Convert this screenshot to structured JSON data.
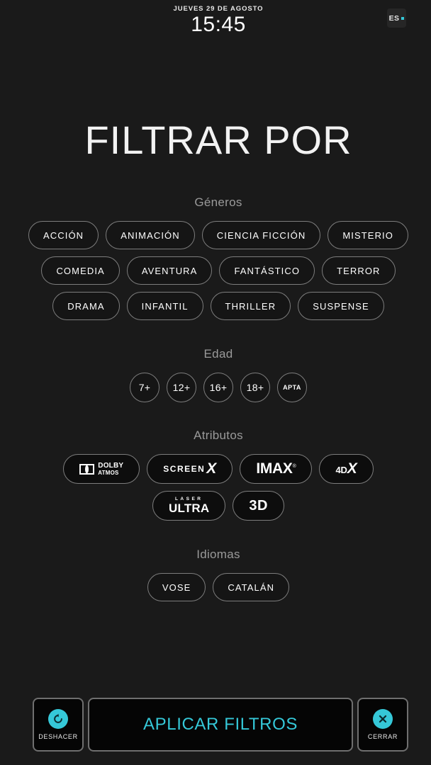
{
  "header": {
    "date": "JUEVES 29 DE AGOSTO",
    "time": "15:45",
    "language": "ES"
  },
  "page_title": "FILTRAR POR",
  "sections": {
    "generos": {
      "title": "Géneros",
      "rows": [
        [
          "ACCIÓN",
          "ANIMACIÓN",
          "CIENCIA FICCIÓN",
          "MISTERIO"
        ],
        [
          "COMEDIA",
          "AVENTURA",
          "FANTÁSTICO",
          "TERROR"
        ],
        [
          "DRAMA",
          "INFANTIL",
          "THRILLER",
          "SUSPENSE"
        ]
      ]
    },
    "edad": {
      "title": "Edad",
      "items": [
        "7+",
        "12+",
        "16+",
        "18+",
        "APTA"
      ]
    },
    "atributos": {
      "title": "Atributos",
      "items": [
        {
          "id": "dolby-atmos",
          "line1": "DOLBY",
          "line2": "ATMOS"
        },
        {
          "id": "screenx",
          "word": "SCREEN",
          "mark": "X"
        },
        {
          "id": "imax",
          "word": "IMAX",
          "mark": "®"
        },
        {
          "id": "4dx",
          "word": "4D",
          "mark": "X"
        },
        {
          "id": "laser-ultra",
          "line1": "LASER",
          "line2": "ULTRA"
        },
        {
          "id": "3d",
          "word": "3D"
        }
      ]
    },
    "idiomas": {
      "title": "Idiomas",
      "items": [
        "VOSE",
        "CATALÁN"
      ]
    }
  },
  "bottom_bar": {
    "undo_label": "DESHACER",
    "apply_label": "APLICAR FILTROS",
    "close_label": "CERRAR"
  },
  "colors": {
    "accent": "#35c8d8",
    "background": "#1a1a1a",
    "chip_border": "#7d7d7d",
    "section_title": "#9a9a9a"
  }
}
